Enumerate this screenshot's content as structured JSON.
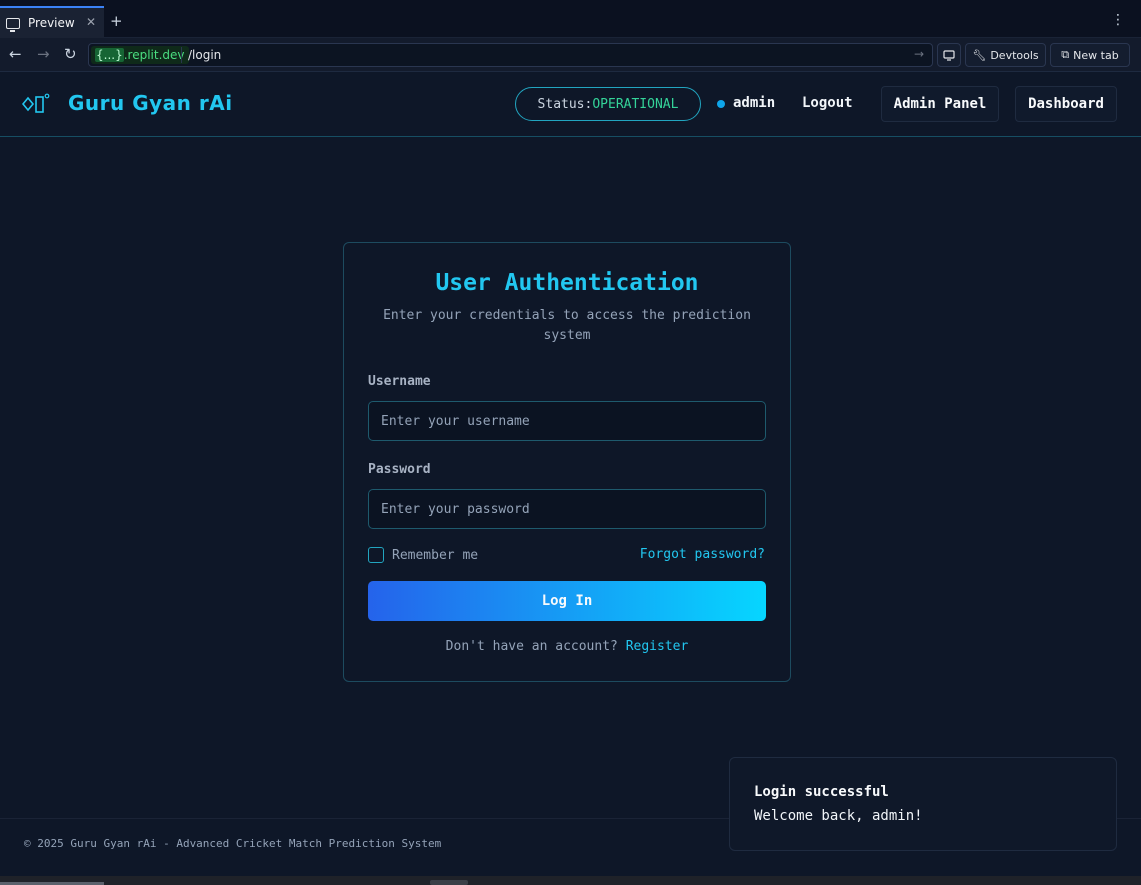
{
  "browser": {
    "tab_title": "Preview",
    "url_host_prefix": "{...}",
    "url_host": ".replit.dev",
    "url_path": "/login",
    "devtools_label": "Devtools",
    "newtab_label": "New tab"
  },
  "header": {
    "brand": "Guru Gyan rAi",
    "status_label": "Status:",
    "status_value": "OPERATIONAL",
    "user": "admin",
    "logout": "Logout",
    "admin_panel": "Admin Panel",
    "dashboard": "Dashboard"
  },
  "login": {
    "title": "User Authentication",
    "subtitle": "Enter your credentials to access the prediction system",
    "username_label": "Username",
    "username_placeholder": "Enter your username",
    "password_label": "Password",
    "password_placeholder": "Enter your password",
    "remember_label": "Remember me",
    "forgot_label": "Forgot password?",
    "submit_label": "Log In",
    "register_prompt": "Don't have an account?",
    "register_label": "Register"
  },
  "footer": {
    "text": "© 2025 Guru Gyan rAi - Advanced Cricket Match Prediction System"
  },
  "toast": {
    "title": "Login successful",
    "message": "Welcome back, admin!"
  },
  "colors": {
    "background": "#0e1728",
    "accent": "#22c7f0",
    "status_ok": "#34d399",
    "button_gradient_start": "#2563eb",
    "button_gradient_end": "#06d6ff"
  }
}
